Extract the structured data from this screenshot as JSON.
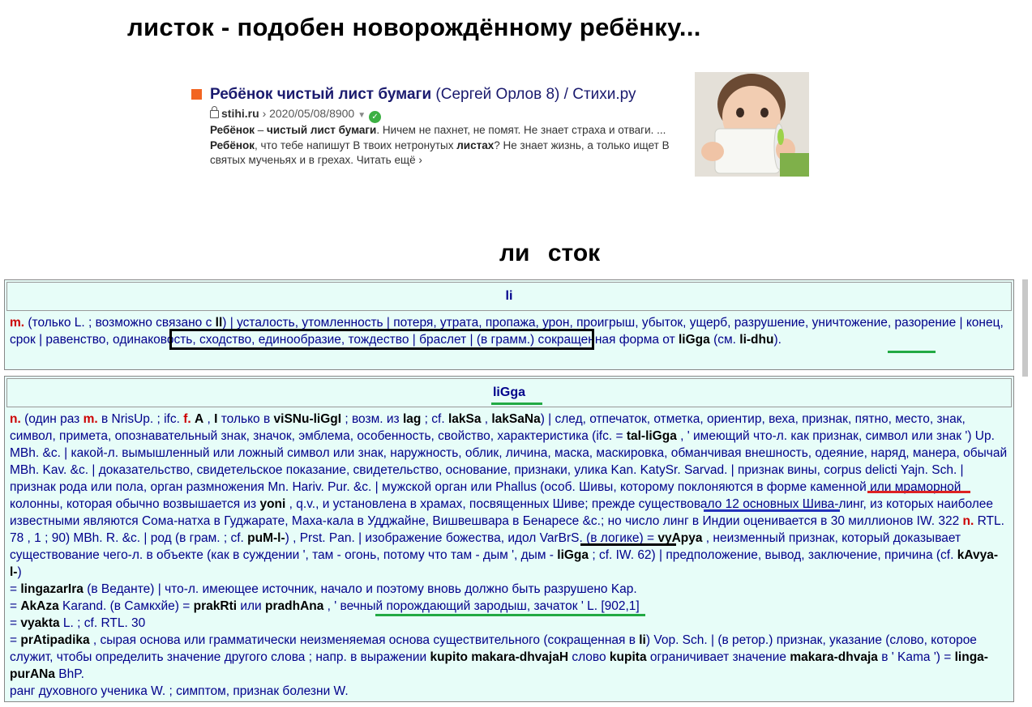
{
  "page_title": "листок - подобен новорождённому ребёнку...",
  "search_result": {
    "title_bold": "Ребёнок чистый лист бумаги",
    "title_rest": " (Сергей Орлов 8) / Стихи.ру",
    "site": "stihi.ru",
    "path": "› 2020/05/08/8900",
    "snippet": {
      "p1": "Ребёнок",
      "p2": " – ",
      "p3": "чистый лист бумаги",
      "p4": ". Ничем не пахнет, не помят. Не знает страха и отваги. ... ",
      "p5": "Ребёнок",
      "p6": ", что тебе напишут В твоих нетронутых ",
      "p7": "листах",
      "p8": "? Не знает жизнь, а только ищет В святых мученьях и в грехах. ",
      "read_more": "Читать ещё ›"
    }
  },
  "sub_title": "ли сток",
  "entry_li": {
    "head": "li",
    "gram": "m.",
    "text1": " (только L. ; возможно связано с ",
    "kw_li": "ll",
    "text2": ") | усталость, утомленность | потеря, утрата, пропажа, урон, проигрыш, убыток, ущерб, разрушение, уничтожение, разорение | конец, срок | равенство, одинаковость, сходство, единообразие, тождество | браслет | (в грамм.) сокращенная форма от ",
    "kw_ligga": "liGga",
    "text3": " (см. ",
    "kw_lidhu": "li-dhu",
    "text4": ")."
  },
  "entry_ligga": {
    "head": "liGga",
    "seg": [
      {
        "c": "gm",
        "t": "n."
      },
      {
        "t": " (один раз "
      },
      {
        "c": "gm",
        "t": "m."
      },
      {
        "t": " в NrisUp. ; ifc. "
      },
      {
        "c": "gm",
        "t": "f."
      },
      {
        "t": " "
      },
      {
        "c": "kw",
        "t": "A"
      },
      {
        "t": " , "
      },
      {
        "c": "kw",
        "t": "I"
      },
      {
        "t": " только в "
      },
      {
        "c": "kw",
        "t": "viSNu-liGgI"
      },
      {
        "t": " ; возм. из "
      },
      {
        "c": "kw",
        "t": "lag"
      },
      {
        "t": " ; cf. "
      },
      {
        "c": "kw",
        "t": "lakSa"
      },
      {
        "t": " , "
      },
      {
        "c": "kw",
        "t": "lakSaNa"
      },
      {
        "t": ") | след, отпечаток, отметка, ориентир, веха, признак, пятно, место, знак, символ, примета, опознавательный знак, значок, эмблема, особенность, свойство, характеристика (ifc. = "
      },
      {
        "c": "kw",
        "t": "tal-liGga"
      },
      {
        "t": " , ' имеющий что-л. как признак, символ или знак ') Up. MBh. &c. | какой-л. вымышленный или ложный символ или знак, наружность, облик, личина, маска, маскировка, обманчивая внешность, одеяние, наряд, манера, обычай MBh. Kav. &c. | доказательство, свидетельское показание, свидетельство, основание, признаки, улика Kan. KatySr. Sarvad. | признак вины, corpus delicti Yajn. Sch. | признак рода или пола, орган размножения Mn. Hariv. Pur. &c. | мужской орган или Phallus (особ. Шивы, которому поклоняются в форме каменной или мраморной колонны, которая обычно возвышается из "
      },
      {
        "c": "kw",
        "t": "yoni"
      },
      {
        "t": " , q.v., и установлена в храмах, посвященных Шиве; прежде существовало 12 основных Шива-линг, из которых наиболее известными являются Сома-натха в Гуджарате, Маха-кала в Удджайне, Вишвешвара в Бенаресе &c.; но число линг в Индии оценивается в 30 миллионов IW. 322 "
      },
      {
        "c": "gm",
        "t": "n."
      },
      {
        "t": " RTL. 78 , 1 ; 90) MBh. R. &c. | род (в грам. ; cf. "
      },
      {
        "c": "kw",
        "t": "puM-l-"
      },
      {
        "t": ") , Prst. Pan. | изображение божества, идол VarBrS. (в логике) = "
      },
      {
        "c": "kw",
        "t": "vyApya"
      },
      {
        "t": " , неизменный признак, который доказывает существование чего-л. в объекте (как в суждении ', там - огонь, потому что там - дым ', дым - "
      },
      {
        "c": "kw",
        "t": "liGga"
      },
      {
        "t": " ; cf. IW. 62) | предположение, вывод, заключение, причина (cf. "
      },
      {
        "c": "kw",
        "t": "kAvya-l-"
      },
      {
        "t": ")"
      },
      {
        "br": true
      },
      {
        "t": "= "
      },
      {
        "c": "kw",
        "t": "lingazarIra"
      },
      {
        "t": " (в Веданте) | что-л. имеющее источник, начало и поэтому вновь должно быть разрушено Kap."
      },
      {
        "br": true
      },
      {
        "t": "= "
      },
      {
        "c": "kw",
        "t": "AkAza"
      },
      {
        "t": " Karand. (в Самкхйе) = "
      },
      {
        "c": "kw",
        "t": "prakRti"
      },
      {
        "t": " или "
      },
      {
        "c": "kw",
        "t": "pradhAna"
      },
      {
        "t": " , ' вечный порождающий зародыш, зачаток ' L. [902,1]"
      },
      {
        "br": true
      },
      {
        "t": "= "
      },
      {
        "c": "kw",
        "t": "vyakta"
      },
      {
        "t": " L. ; cf. RTL. 30"
      },
      {
        "br": true
      },
      {
        "t": "= "
      },
      {
        "c": "kw",
        "t": "prAtipadika"
      },
      {
        "t": " , сырая основа или грамматически неизменяемая основа существительного (сокращенная в "
      },
      {
        "c": "kw",
        "t": "li"
      },
      {
        "t": ") Vop. Sch. | (в ретор.) признак, указание (слово, которое служит, чтобы определить значение другого слова ; напр. в выражении "
      },
      {
        "c": "kw",
        "t": "kupito makara-dhvajaH"
      },
      {
        "t": " слово "
      },
      {
        "c": "kw",
        "t": "kupita"
      },
      {
        "t": " ограничивает значение "
      },
      {
        "c": "kw",
        "t": "makara-dhvaja"
      },
      {
        "t": " в ' Kama ') = "
      },
      {
        "c": "kw",
        "t": "linga-purANa"
      },
      {
        "t": " BhP."
      },
      {
        "br": true
      },
      {
        "t": "ранг духовного ученика W. ; симптом, признак болезни W."
      }
    ]
  },
  "colors": {
    "green_mark": "#22aa44",
    "red_mark": "#dd2222",
    "blue_mark": "#2233bb",
    "black_mark": "#000000"
  }
}
